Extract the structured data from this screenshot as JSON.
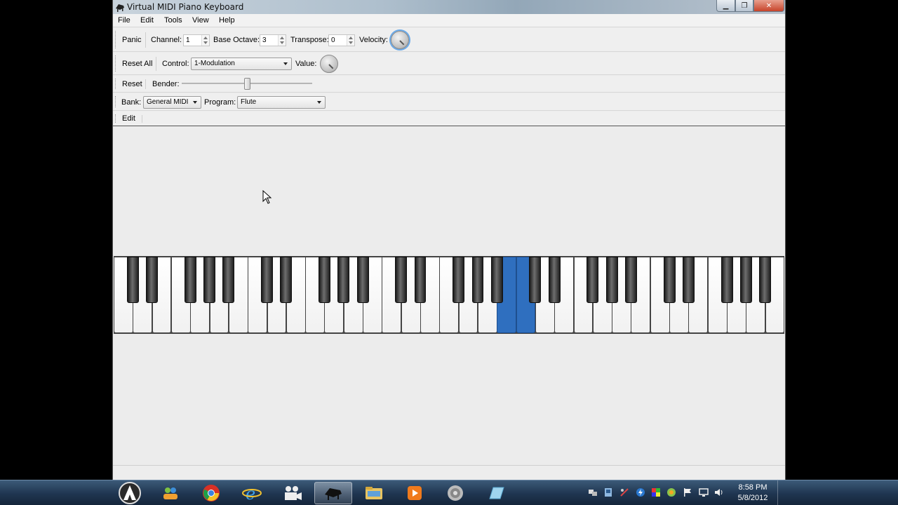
{
  "window": {
    "title": "Virtual MIDI Piano Keyboard",
    "minimize_glyph": "▁",
    "maximize_glyph": "❐",
    "close_glyph": "✕"
  },
  "menu": {
    "items": [
      "File",
      "Edit",
      "Tools",
      "View",
      "Help"
    ]
  },
  "toolbar1": {
    "panic_label": "Panic",
    "channel_label": "Channel:",
    "channel_value": "1",
    "base_octave_label": "Base Octave:",
    "base_octave_value": "3",
    "transpose_label": "Transpose:",
    "transpose_value": "0",
    "velocity_label": "Velocity:"
  },
  "toolbar2": {
    "reset_all_label": "Reset All",
    "control_label": "Control:",
    "control_value": "1-Modulation",
    "value_label": "Value:"
  },
  "toolbar3": {
    "reset_label": "Reset",
    "bender_label": "Bender:",
    "bender_level": 0.5
  },
  "toolbar4": {
    "bank_label": "Bank:",
    "bank_value": "General MIDI",
    "program_label": "Program:",
    "program_value": "Flute"
  },
  "toolbar5": {
    "edit_label": "Edit"
  },
  "piano": {
    "white_key_count": 35,
    "pressed_white_keys": [
      20,
      21
    ],
    "key_color_pressed": "#2f6fbf"
  },
  "taskbar": {
    "clock_time": "8:58 PM",
    "clock_date": "5/8/2012",
    "buttons": [
      "start-orb",
      "people-icon",
      "chrome-icon",
      "ie-icon",
      "video-icon",
      "piano-app-icon",
      "folder-icon",
      "media-player-icon",
      "speaker-app-icon",
      "notes-icon"
    ]
  }
}
